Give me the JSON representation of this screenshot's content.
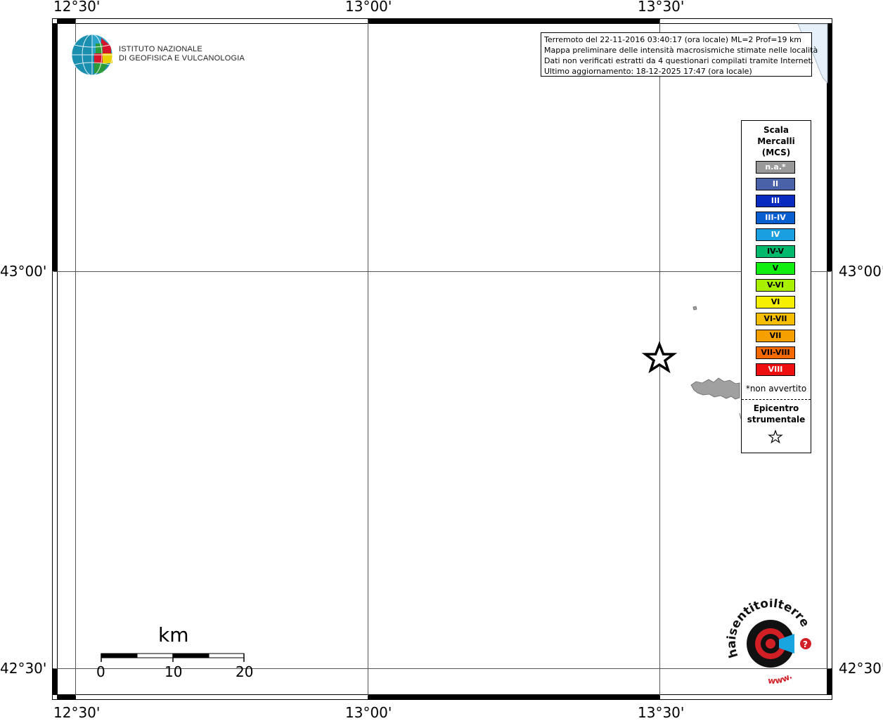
{
  "map": {
    "lon_labels": [
      "12°30'",
      "13°00'",
      "13°30'"
    ],
    "lat_labels": [
      "43°00'",
      "42°30'"
    ]
  },
  "info": {
    "line1": "Terremoto del 22-11-2016 03:40:17 (ora locale) ML=2 Prof=19 km",
    "line2": "Mappa preliminare delle intensità macrosismiche stimate nelle località",
    "line3": "Dati non verificati estratti da 4 questionari compilati tramite Internet.",
    "line4": "Ultimo aggiornamento: 18-12-2025 17:47 (ora locale)"
  },
  "logo": {
    "line1": "ISTITUTO NAZIONALE",
    "line2": "DI GEOFISICA E VULCANOLOGIA"
  },
  "legend": {
    "title1": "Scala",
    "title2": "Mercalli",
    "title3": "(MCS)",
    "items": [
      {
        "label": "n.a.*",
        "color": "#999999",
        "text_color": "#ffffff"
      },
      {
        "label": "II",
        "color": "#4a63a8",
        "text_color": "#ffffff"
      },
      {
        "label": "III",
        "color": "#0a2bbf",
        "text_color": "#ffffff"
      },
      {
        "label": "III-IV",
        "color": "#0a5fd0",
        "text_color": "#ffffff"
      },
      {
        "label": "IV",
        "color": "#1a9fe0",
        "text_color": "#ffffff"
      },
      {
        "label": "IV-V",
        "color": "#00b96a",
        "text_color": "#000000"
      },
      {
        "label": "V",
        "color": "#10ef10",
        "text_color": "#000000"
      },
      {
        "label": "V-VI",
        "color": "#a8f000",
        "text_color": "#000000"
      },
      {
        "label": "VI",
        "color": "#f6f000",
        "text_color": "#000000"
      },
      {
        "label": "VI-VII",
        "color": "#f6be00",
        "text_color": "#000000"
      },
      {
        "label": "VII",
        "color": "#f6a000",
        "text_color": "#000000"
      },
      {
        "label": "VII-VIII",
        "color": "#f66800",
        "text_color": "#000000"
      },
      {
        "label": "VIII",
        "color": "#ee1010",
        "text_color": "#ffffff"
      }
    ],
    "note": "*non avvertito",
    "epi1": "Epicentro",
    "epi2": "strumentale"
  },
  "scale": {
    "title": "km",
    "ticks": [
      "0",
      "10",
      "20"
    ]
  },
  "badge": {
    "text_top": "haisentitoilterremoto.it",
    "text_bottom": "www.",
    "question": "?"
  }
}
